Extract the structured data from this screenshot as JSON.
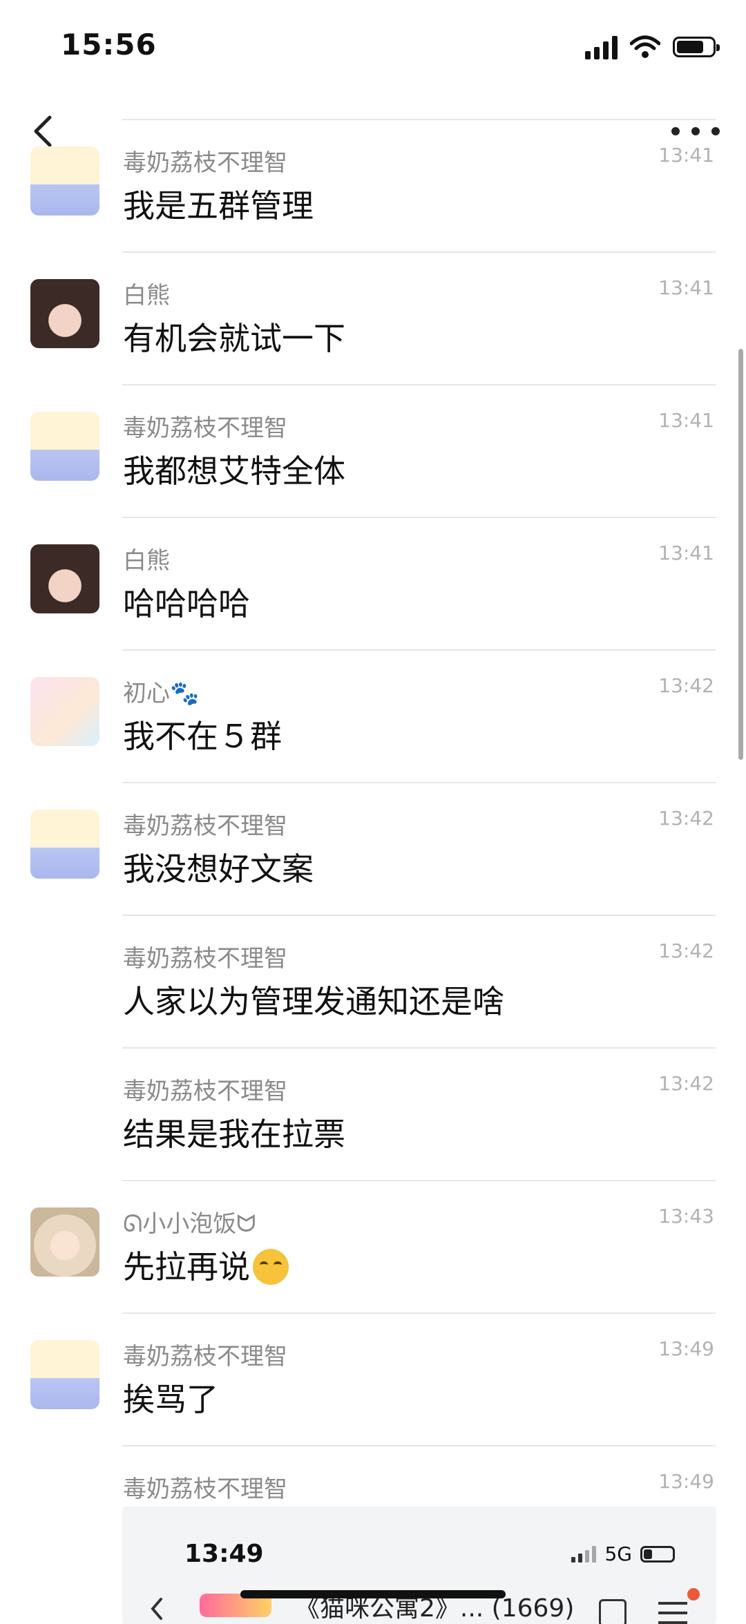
{
  "status_bar": {
    "time": "15:56"
  },
  "scrollbar_position": 0.3,
  "messages": [
    {
      "sender": "毒奶荔枝不理智",
      "time": "13:41",
      "text": "我是五群管理",
      "avatar": "tom-jerry-avatar",
      "show_avatar": true
    },
    {
      "sender": "白熊",
      "time": "13:41",
      "text": "有机会就试一下",
      "avatar": "girl-avatar",
      "show_avatar": true
    },
    {
      "sender": "毒奶荔枝不理智",
      "time": "13:41",
      "text": "我都想艾特全体",
      "avatar": "tom-jerry-avatar",
      "show_avatar": true
    },
    {
      "sender": "白熊",
      "time": "13:41",
      "text": "哈哈哈哈",
      "avatar": "girl-avatar",
      "show_avatar": true
    },
    {
      "sender": "初心🐾",
      "time": "13:42",
      "text": "我不在５群",
      "avatar": "anime-girl-avatar",
      "show_avatar": true
    },
    {
      "sender": "毒奶荔枝不理智",
      "time": "13:42",
      "text": "我没想好文案",
      "avatar": "tom-jerry-avatar",
      "show_avatar": true
    },
    {
      "sender": "毒奶荔枝不理智",
      "time": "13:42",
      "text": "人家以为管理发通知还是啥",
      "avatar": "",
      "show_avatar": false
    },
    {
      "sender": "毒奶荔枝不理智",
      "time": "13:42",
      "text": "结果是我在拉票",
      "avatar": "",
      "show_avatar": false
    },
    {
      "sender": "ᘏ小小泡饭ᗢ",
      "time": "13:43",
      "text": "先拉再说",
      "avatar": "cartoon-kid-avatar",
      "show_avatar": true,
      "emoji": "thinking-emoji"
    },
    {
      "sender": "毒奶荔枝不理智",
      "time": "13:49",
      "text": "挨骂了",
      "avatar": "tom-jerry-avatar",
      "show_avatar": true
    },
    {
      "sender": "毒奶荔枝不理智",
      "time": "13:49",
      "text": "",
      "avatar": "",
      "show_avatar": false
    }
  ],
  "screenshot_preview": {
    "time": "13:49",
    "network": "5G",
    "title": "《猫咪公寓2》... (1669)",
    "battery_level": 0.2
  }
}
